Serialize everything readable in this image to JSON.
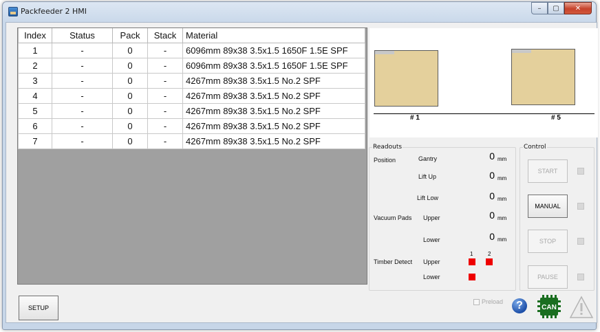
{
  "window": {
    "title": "Packfeeder 2 HMI",
    "minimize": "–",
    "maximize": "▢",
    "close": "✕"
  },
  "table": {
    "columns": [
      "Index",
      "Status",
      "Pack",
      "Stack",
      "Material"
    ],
    "rows": [
      [
        "1",
        "-",
        "0",
        "-",
        "6096mm 89x38 3.5x1.5 1650F 1.5E SPF"
      ],
      [
        "2",
        "-",
        "0",
        "-",
        "6096mm 89x38 3.5x1.5 1650F 1.5E SPF"
      ],
      [
        "3",
        "-",
        "0",
        "-",
        "4267mm 89x38 3.5x1.5 No.2 SPF"
      ],
      [
        "4",
        "-",
        "0",
        "-",
        "4267mm 89x38 3.5x1.5 No.2 SPF"
      ],
      [
        "5",
        "-",
        "0",
        "-",
        "4267mm 89x38 3.5x1.5 No.2 SPF"
      ],
      [
        "6",
        "-",
        "0",
        "-",
        "4267mm 89x38 3.5x1.5 No.2 SPF"
      ],
      [
        "7",
        "-",
        "0",
        "-",
        "4267mm 89x38 3.5x1.5 No.2 SPF"
      ]
    ]
  },
  "preview": {
    "slot1_label": "# 1",
    "slot2_label": "# 5",
    "pack_color": "#e4d09c"
  },
  "readouts": {
    "legend": "Readouts",
    "position_label": "Position",
    "gantry_label": "Gantry",
    "gantry_value": "0",
    "lift_up_label": "Lift Up",
    "lift_up_value": "0",
    "lift_low_label": "Lift Low",
    "lift_low_value": "0",
    "vacuum_label": "Vacuum Pads",
    "upper_label": "Upper",
    "upper_value": "0",
    "lower_label": "Lower",
    "lower_value": "0",
    "unit": "mm",
    "timber_label": "Timber Detect",
    "timber_upper_label": "Upper",
    "timber_lower_label": "Lower",
    "col1": "1",
    "col2": "2",
    "indicator_color": "#ee0000"
  },
  "control": {
    "legend": "Control",
    "start": "START",
    "manual": "MANUAL",
    "stop": "STOP",
    "pause": "PAUSE"
  },
  "footer": {
    "setup": "SETUP",
    "preload": "Preload",
    "help": "?",
    "can": "CAN"
  }
}
